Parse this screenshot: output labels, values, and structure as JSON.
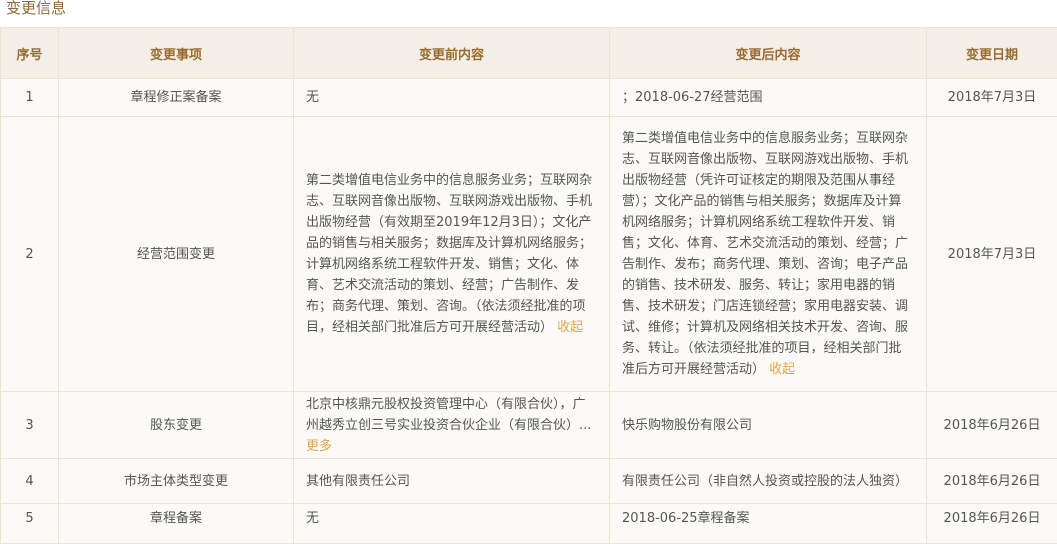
{
  "section": {
    "title": "变更信息"
  },
  "table": {
    "headers": [
      "序号",
      "变更事项",
      "变更前内容",
      "变更后内容",
      "变更日期"
    ],
    "rows": [
      {
        "index": "1",
        "item": "章程修正案备案",
        "before": "无",
        "after": "；2018-06-27经营范围",
        "date": "2018年7月3日"
      },
      {
        "index": "2",
        "item": "经营范围变更",
        "before": "第二类增值电信业务中的信息服务业务；互联网杂志、互联网音像出版物、互联网游戏出版物、手机出版物经营（有效期至2019年12月3日）；文化产品的销售与相关服务；数据库及计算机网络服务；计算机网络系统工程软件开发、销售；文化、体育、艺术交流活动的策划、经营；广告制作、发布；商务代理、策划、咨询。（依法须经批准的项目，经相关部门批准后方可开展经营活动）",
        "before_toggle": "收起",
        "after": "第二类增值电信业务中的信息服务业务；互联网杂志、互联网音像出版物、互联网游戏出版物、手机出版物经营（凭许可证核定的期限及范围从事经营）；文化产品的销售与相关服务；数据库及计算机网络服务；计算机网络系统工程软件开发、销售；文化、体育、艺术交流活动的策划、经营；广告制作、发布；商务代理、策划、咨询；电子产品的销售、技术研发、服务、转让；家用电器的销售、技术研发；门店连锁经营；家用电器安装、调试、维修；计算机及网络相关技术开发、咨询、服务、转让。（依法须经批准的项目，经相关部门批准后方可开展经营活动）",
        "after_toggle": "收起",
        "date": "2018年7月3日"
      },
      {
        "index": "3",
        "item": "股东变更",
        "before": "北京中核鼎元股权投资管理中心（有限合伙），广州越秀立创三号实业投资合伙企业（有限合伙）...",
        "before_toggle": "更多",
        "after": "快乐购物股份有限公司",
        "date": "2018年6月26日"
      },
      {
        "index": "4",
        "item": "市场主体类型变更",
        "before": "其他有限责任公司",
        "after": "有限责任公司（非自然人投资或控股的法人独资）",
        "date": "2018年6月26日"
      },
      {
        "index": "5",
        "item": "章程备案",
        "before": "无",
        "after": "2018-06-25章程备案",
        "date": "2018年6月26日"
      }
    ]
  }
}
